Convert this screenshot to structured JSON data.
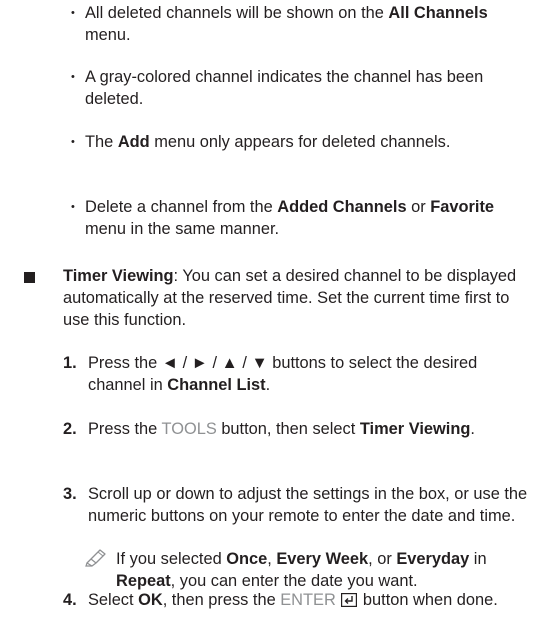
{
  "bullets": [
    {
      "t1": "All deleted channels will be shown on the ",
      "b1": "All Channels",
      "t2": " menu."
    },
    {
      "t1": "A gray-colored channel indicates the channel has been deleted."
    },
    {
      "t1": "The ",
      "b1": "Add",
      "t2": " menu only appears for deleted channels."
    },
    {
      "t1": "Delete a channel from the ",
      "b1": "Added Channels",
      "t2": " or ",
      "b2": "Favorite",
      "t3": " menu in the same manner."
    }
  ],
  "section": {
    "title": "Timer Viewing",
    "body": ": You can set a desired channel to be displayed automatically at the reserved time. Set the current time first to use this function."
  },
  "steps": [
    {
      "num": "1.",
      "t1": "Press the ◄ / ► / ▲ / ▼ buttons to select the desired channel in ",
      "b1": "Channel List",
      "t2": "."
    },
    {
      "num": "2.",
      "t1": "Press the ",
      "g1": "TOOLS",
      "t2": " button, then select ",
      "b1": "Timer Viewing",
      "t3": "."
    },
    {
      "num": "3.",
      "t1": "Scroll up or down to adjust the settings in the box, or use the numeric buttons on your remote to enter the date and time."
    },
    {
      "num": "4.",
      "t1": "Select ",
      "b1": "OK",
      "t2": ", then press the ",
      "g1": "ENTER",
      "t3": " button when done."
    }
  ],
  "note": {
    "t1": "If you selected ",
    "b1": "Once",
    "t2": ", ",
    "b2": "Every Week",
    "t3": ", or ",
    "b3": "Everyday",
    "t4": " in ",
    "b4": "Repeat",
    "t5": ", you can enter the date you want."
  }
}
